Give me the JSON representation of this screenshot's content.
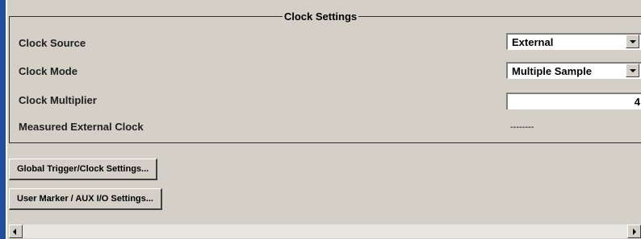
{
  "clock_settings": {
    "title": "Clock Settings",
    "clock_source": {
      "label": "Clock Source",
      "value": "External"
    },
    "clock_mode": {
      "label": "Clock Mode",
      "value": "Multiple Sample"
    },
    "clock_multiplier": {
      "label": "Clock Multiplier",
      "value": "4"
    },
    "measured_external_clock": {
      "label": "Measured External Clock",
      "value": "--------"
    }
  },
  "buttons": {
    "global_trigger": "Global Trigger/Clock Settings...",
    "user_marker": "User Marker / AUX I/O Settings..."
  },
  "icons": {
    "dropdown": "chevron-down-icon",
    "scroll_left": "arrow-left-icon",
    "scroll_right": "arrow-right-icon"
  },
  "colors": {
    "panel_background": "#d4d0c8",
    "accent_bar": "#1f4f9e",
    "field_background": "#ffffff"
  }
}
